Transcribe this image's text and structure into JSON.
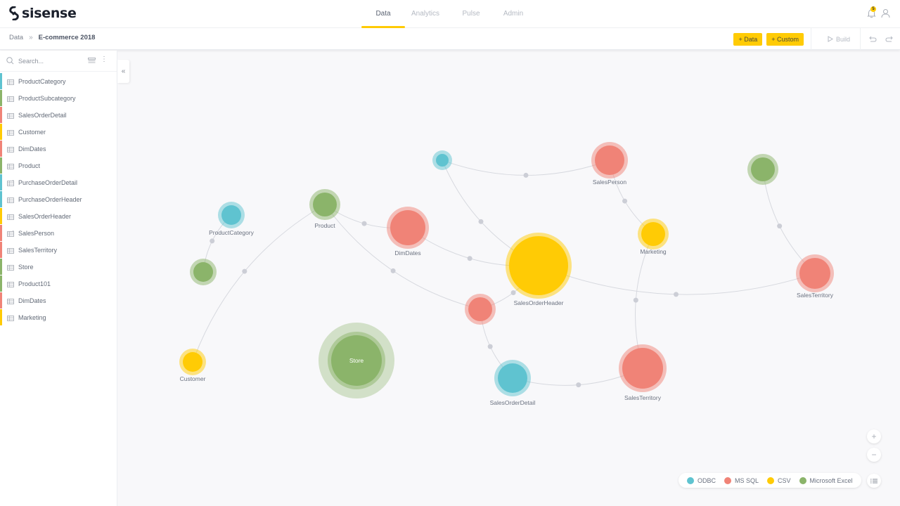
{
  "app": {
    "brand": "sisense"
  },
  "nav": {
    "tabs": [
      {
        "label": "Data",
        "active": true
      },
      {
        "label": "Analytics",
        "active": false
      },
      {
        "label": "Pulse",
        "active": false
      },
      {
        "label": "Admin",
        "active": false
      }
    ],
    "notification_count": "5"
  },
  "breadcrumb": {
    "root": "Data",
    "separator": "»",
    "current": "E-commerce 2018"
  },
  "toolbar": {
    "add_data_label": "+ Data",
    "add_custom_label": "+ Custom",
    "build_label": "Build"
  },
  "sidebar": {
    "search_placeholder": "Search...",
    "tables": [
      {
        "name": "ProductCategory",
        "source": "ODBC",
        "custom": false
      },
      {
        "name": "ProductSubcategory",
        "source": "Microsoft Excel",
        "custom": false
      },
      {
        "name": "SalesOrderDetail",
        "source": "MS SQL",
        "custom": false
      },
      {
        "name": "Customer",
        "source": "CSV",
        "custom": false
      },
      {
        "name": "DimDates",
        "source": "MS SQL",
        "custom": false
      },
      {
        "name": "Product",
        "source": "Microsoft Excel",
        "custom": false
      },
      {
        "name": "PurchaseOrderDetail",
        "source": "ODBC",
        "custom": true
      },
      {
        "name": "PurchaseOrderHeader",
        "source": "ODBC",
        "custom": false
      },
      {
        "name": "SalesOrderHeader",
        "source": "CSV",
        "custom": false
      },
      {
        "name": "SalesPerson",
        "source": "MS SQL",
        "custom": true
      },
      {
        "name": "SalesTerritory",
        "source": "MS SQL",
        "custom": false
      },
      {
        "name": "Store",
        "source": "Microsoft Excel",
        "custom": false
      },
      {
        "name": "Product101",
        "source": "Microsoft Excel",
        "custom": false
      },
      {
        "name": "DimDates",
        "source": "MS SQL",
        "custom": false
      },
      {
        "name": "Marketing",
        "source": "CSV",
        "custom": false
      }
    ]
  },
  "legend": [
    {
      "label": "ODBC",
      "color": "#5fc3d0"
    },
    {
      "label": "MS SQL",
      "color": "#f08377"
    },
    {
      "label": "CSV",
      "color": "#ffcb05"
    },
    {
      "label": "Microsoft Excel",
      "color": "#8bb46a"
    }
  ],
  "colors": {
    "ODBC": "#5fc3d0",
    "MS SQL": "#f08377",
    "CSV": "#ffcb05",
    "Microsoft Excel": "#8bb46a",
    "accent": "#ffcb05"
  },
  "graph": {
    "nodes": [
      {
        "id": "n_odbc_small",
        "label": "",
        "source": "ODBC"
      },
      {
        "id": "n_salesperson",
        "label": "SalesPerson",
        "source": "MS SQL"
      },
      {
        "id": "n_excel_tr",
        "label": "",
        "source": "Microsoft Excel"
      },
      {
        "id": "n_productcategory",
        "label": "ProductCategory",
        "source": "ODBC"
      },
      {
        "id": "n_product",
        "label": "Product",
        "source": "Microsoft Excel"
      },
      {
        "id": "n_dimdates",
        "label": "DimDates",
        "source": "MS SQL"
      },
      {
        "id": "n_marketing",
        "label": "Marketing",
        "source": "CSV"
      },
      {
        "id": "n_salesorderheader",
        "label": "SalesOrderHeader",
        "source": "CSV"
      },
      {
        "id": "n_salesterritory_r",
        "label": "SalesTerritory",
        "source": "MS SQL"
      },
      {
        "id": "n_excel_l",
        "label": "",
        "source": "Microsoft Excel"
      },
      {
        "id": "n_mssql_mid",
        "label": "",
        "source": "MS SQL"
      },
      {
        "id": "n_customer",
        "label": "Customer",
        "source": "CSV"
      },
      {
        "id": "n_store",
        "label": "Store",
        "source": "Microsoft Excel",
        "selected": true
      },
      {
        "id": "n_salesorderdetail",
        "label": "SalesOrderDetail",
        "source": "ODBC"
      },
      {
        "id": "n_salesterritory_b",
        "label": "SalesTerritory",
        "source": "MS SQL"
      }
    ],
    "links": [
      [
        "n_odbc_small",
        "n_salesperson"
      ],
      [
        "n_odbc_small",
        "n_salesorderheader"
      ],
      [
        "n_dimdates",
        "n_salesorderheader"
      ],
      [
        "n_product",
        "n_dimdates"
      ],
      [
        "n_product",
        "n_mssql_mid"
      ],
      [
        "n_salesperson",
        "n_marketing"
      ],
      [
        "n_marketing",
        "n_salesterritory_b"
      ],
      [
        "n_salesorderheader",
        "n_salesterritory_r"
      ],
      [
        "n_excel_tr",
        "n_salesterritory_r"
      ],
      [
        "n_productcategory",
        "n_excel_l"
      ],
      [
        "n_product",
        "n_customer"
      ],
      [
        "n_mssql_mid",
        "n_salesorderheader"
      ],
      [
        "n_mssql_mid",
        "n_salesorderdetail"
      ],
      [
        "n_salesorderdetail",
        "n_salesterritory_b"
      ]
    ]
  }
}
